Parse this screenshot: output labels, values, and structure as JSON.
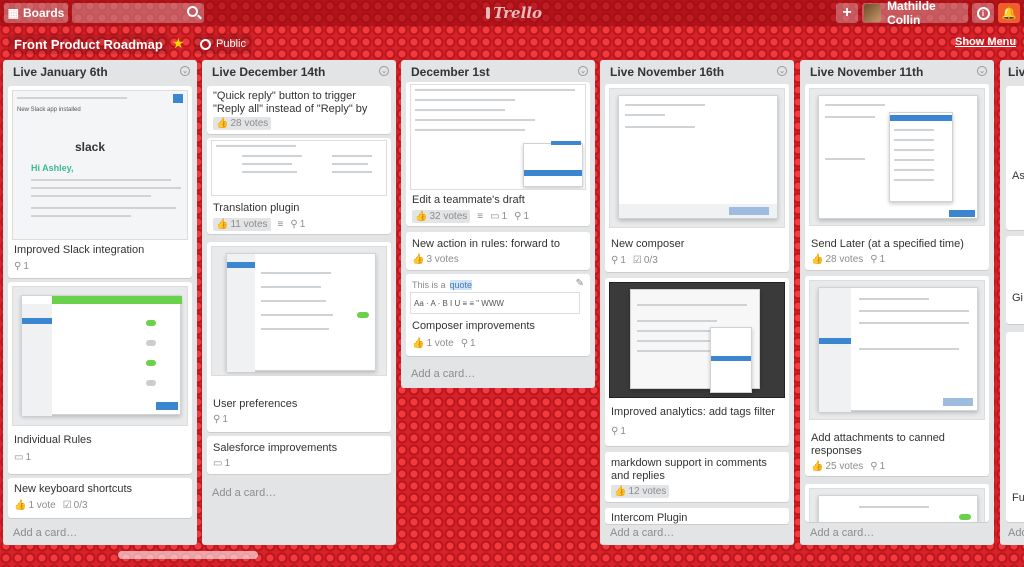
{
  "topbar": {
    "boards": "Boards",
    "logo": "Trello",
    "user": "Mathilde Collin"
  },
  "board": {
    "title": "Front Product Roadmap",
    "visibility": "Public",
    "show_menu": "Show Menu"
  },
  "lists": [
    {
      "title": "Live January 6th",
      "cards": [
        {
          "title": "Improved Slack integration",
          "comments": "1",
          "thumb": {
            "app_bar": "New Slack app installed",
            "brand": "slack",
            "greeting": "Hi Ashley,"
          }
        },
        {
          "title": "Individual Rules",
          "comments": "1"
        },
        {
          "title": "New keyboard shortcuts",
          "votes": "1 vote",
          "checklist": "0/3"
        }
      ],
      "add": "Add a card…"
    },
    {
      "title": "Live December 14th",
      "cards": [
        {
          "title": "\"Quick reply\" button to trigger \"Reply all\" instead of \"Reply\" by default",
          "votes": "28 votes"
        },
        {
          "title": "Translation plugin",
          "votes": "11 votes",
          "comments": "1"
        },
        {
          "title": "User preferences",
          "comments": "1"
        },
        {
          "title": "Salesforce improvements",
          "comments": "1"
        }
      ],
      "add": "Add a card…"
    },
    {
      "title": "December 1st",
      "cards": [
        {
          "title": "Edit a teammate's draft",
          "votes": "32 votes",
          "comments": "1",
          "attachments": "1"
        },
        {
          "title": "New action in rules: forward to",
          "votes": "3 votes"
        },
        {
          "title": "Composer improvements",
          "votes": "1 vote",
          "comments": "1",
          "editor": {
            "placeholder_prefix": "This is a",
            "selected": "quote",
            "toolbar": "Aa · A · B I U ≡ ≡ \" WWW"
          }
        }
      ],
      "add": "Add a card…"
    },
    {
      "title": "Live November 16th",
      "cards": [
        {
          "title": "New composer",
          "comments": "1",
          "checklist": "0/3"
        },
        {
          "title": "Improved analytics: add tags filter",
          "comments": "1"
        },
        {
          "title": "markdown support in comments and replies",
          "votes": "12 votes"
        },
        {
          "title": "Intercom Plugin"
        }
      ],
      "add": "Add a card…"
    },
    {
      "title": "Live November 11th",
      "cards": [
        {
          "title": "Send Later (at a specified time)",
          "votes": "28 votes",
          "comments": "1"
        },
        {
          "title": "Add attachments to canned responses",
          "votes": "25 votes",
          "comments": "1"
        }
      ],
      "add": "Add a card…"
    },
    {
      "title": "Live",
      "cards": [
        {
          "title": "As"
        },
        {
          "title": "Gi"
        },
        {
          "title": "Fu"
        }
      ],
      "add": "Add"
    }
  ]
}
